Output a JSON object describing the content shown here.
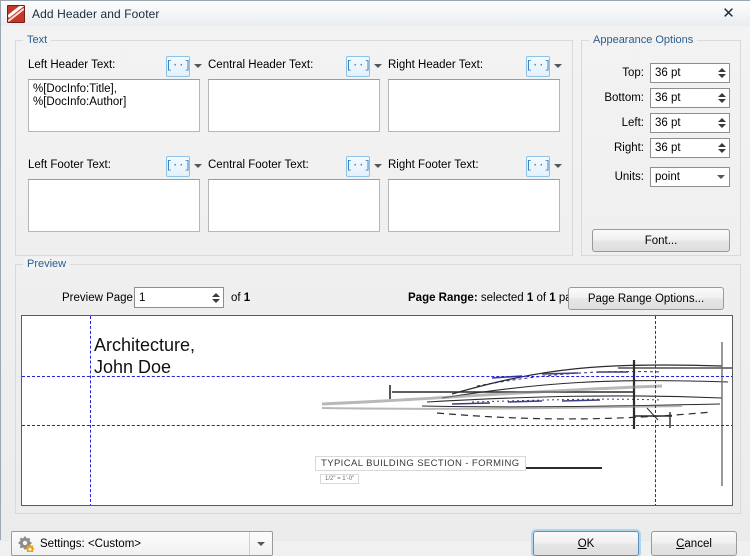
{
  "window": {
    "title": "Add Header and Footer",
    "app_icon": "pdf-app-icon",
    "close_icon": "✕"
  },
  "text_group": {
    "legend": "Text",
    "macro_glyph": "[··]",
    "fields": [
      {
        "label": "Left Header Text:",
        "value": "%[DocInfo:Title],\n%[DocInfo:Author]",
        "name": "left-header"
      },
      {
        "label": "Central Header Text:",
        "value": "",
        "name": "central-header"
      },
      {
        "label": "Right Header Text:",
        "value": "",
        "name": "right-header"
      },
      {
        "label": "Left Footer Text:",
        "value": "",
        "name": "left-footer"
      },
      {
        "label": "Central Footer Text:",
        "value": "",
        "name": "central-footer"
      },
      {
        "label": "Right Footer Text:",
        "value": "",
        "name": "right-footer"
      }
    ]
  },
  "appearance": {
    "legend": "Appearance Options",
    "rows": [
      {
        "label": "Top:",
        "value": "36 pt"
      },
      {
        "label": "Bottom:",
        "value": "36 pt"
      },
      {
        "label": "Left:",
        "value": "36 pt"
      },
      {
        "label": "Right:",
        "value": "36 pt"
      }
    ],
    "units_label": "Units:",
    "units_value": "point",
    "font_button": "Font..."
  },
  "preview": {
    "legend": "Preview",
    "page_label": "Preview Page",
    "page_value": "1",
    "of_prefix": "of ",
    "of_total": "1",
    "range_prefix": "Page Range:",
    "range_mid": " selected ",
    "range_selected": "1",
    "range_of": " of ",
    "range_total": "1",
    "range_suffix": " pages",
    "range_button": "Page Range Options...",
    "header_text": "Architecture,\nJohn Doe",
    "caption": "TYPICAL BUILDING SECTION - FORMING",
    "scale": "1/2\" = 1'-0\""
  },
  "footer": {
    "settings_label": "Settings: <Custom>",
    "settings_icon": "gear-icon",
    "ok_accel": "O",
    "ok_rest": "K",
    "cancel_accel": "C",
    "cancel_rest": "ancel"
  },
  "colors": {
    "legend_blue": "#2b5d8c",
    "guide_blue": "#2222dd",
    "focus_blue": "#aed6f1",
    "macro_blue": "#2d7dc0"
  }
}
